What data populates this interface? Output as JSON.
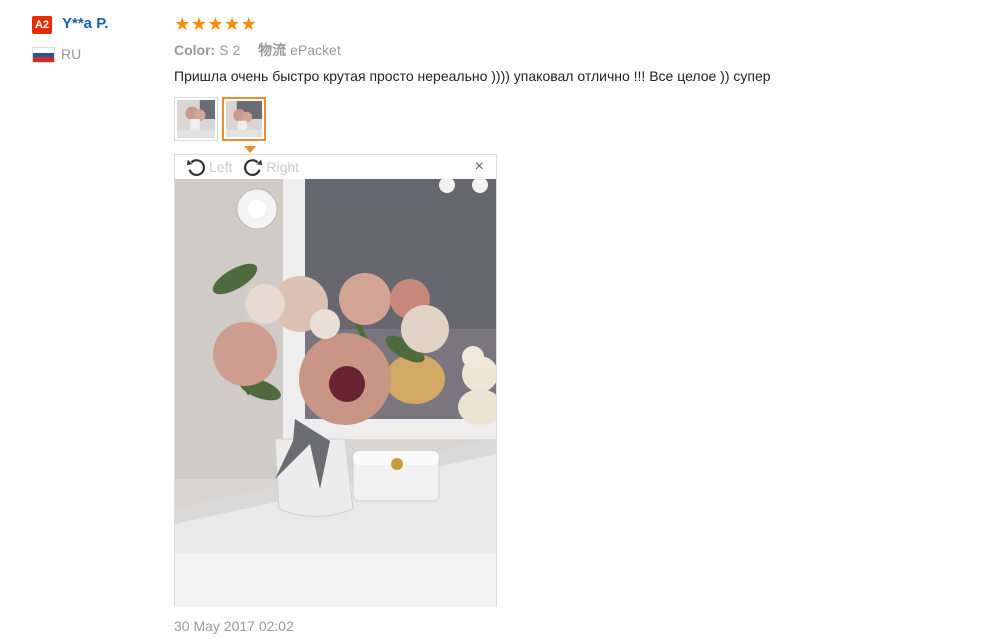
{
  "user": {
    "level_badge": "A2",
    "name": "Y**a P.",
    "country_code": "RU",
    "flag_colors": [
      "#ffffff",
      "#1c57a7",
      "#d52b1e"
    ]
  },
  "review": {
    "rating": 5,
    "stars": [
      "★",
      "★",
      "★",
      "★",
      "★"
    ],
    "color_label": "Color:",
    "color_value": "S 2",
    "logistics_label": "物流",
    "logistics_value": "ePacket",
    "text": "Пришла очень быстро крутая просто нереально )))) упаковал отлично !!! Все целое )) супер",
    "date": "30 May 2017 02:02"
  },
  "viewer": {
    "rotate_left_label": "Left",
    "rotate_right_label": "Right",
    "close_glyph": "×",
    "accent_color": "#f08a2f"
  }
}
